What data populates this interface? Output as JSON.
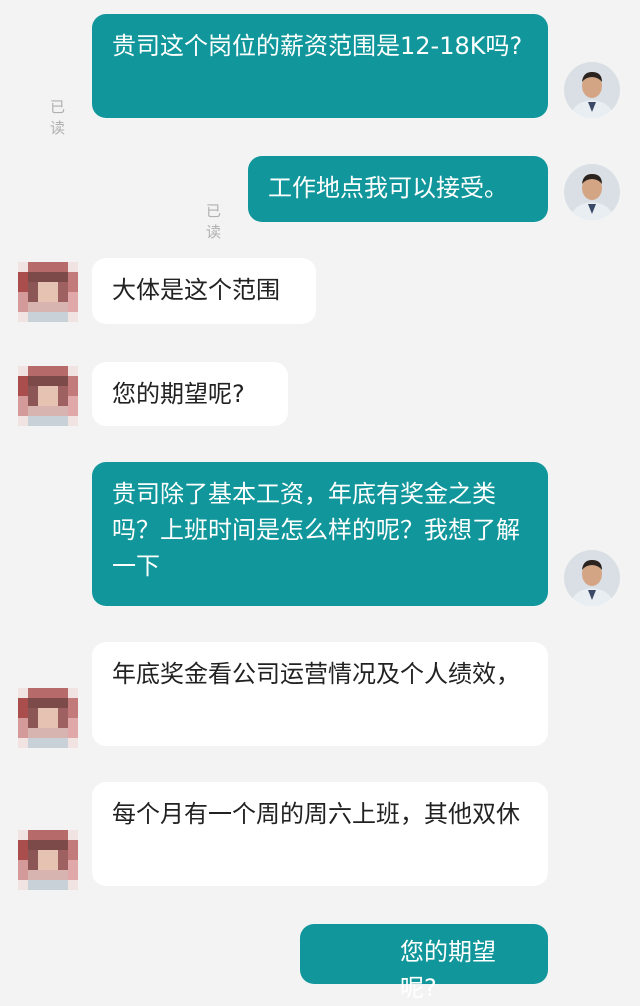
{
  "colors": {
    "background": "#f3f3f3",
    "sent_bubble": "#11979b",
    "received_bubble": "#ffffff"
  },
  "messages": [
    {
      "sender": "me",
      "text": "贵司这个岗位的薪资范围是12-18K吗?",
      "status": "已读",
      "avatar": "user-avatar-man"
    },
    {
      "sender": "me",
      "text": "工作地点我可以接受。",
      "status": "已读",
      "avatar": "user-avatar-man"
    },
    {
      "sender": "other",
      "text": "大体是这个范围",
      "avatar": "pixelated-avatar"
    },
    {
      "sender": "other",
      "text": "您的期望呢?",
      "avatar": "pixelated-avatar"
    },
    {
      "sender": "me",
      "text": "贵司除了基本工资，年底有奖金之类吗？上班时间是怎么样的呢？我想了解一下",
      "avatar": "user-avatar-man"
    },
    {
      "sender": "other",
      "text": "年底奖金看公司运营情况及个人绩效，",
      "avatar": "pixelated-avatar"
    },
    {
      "sender": "other",
      "text": "每个月有一个周的周六上班，其他双休",
      "avatar": "pixelated-avatar"
    },
    {
      "sender": "me",
      "text": "您的期望呢?",
      "avatar": "user-avatar-man"
    }
  ]
}
